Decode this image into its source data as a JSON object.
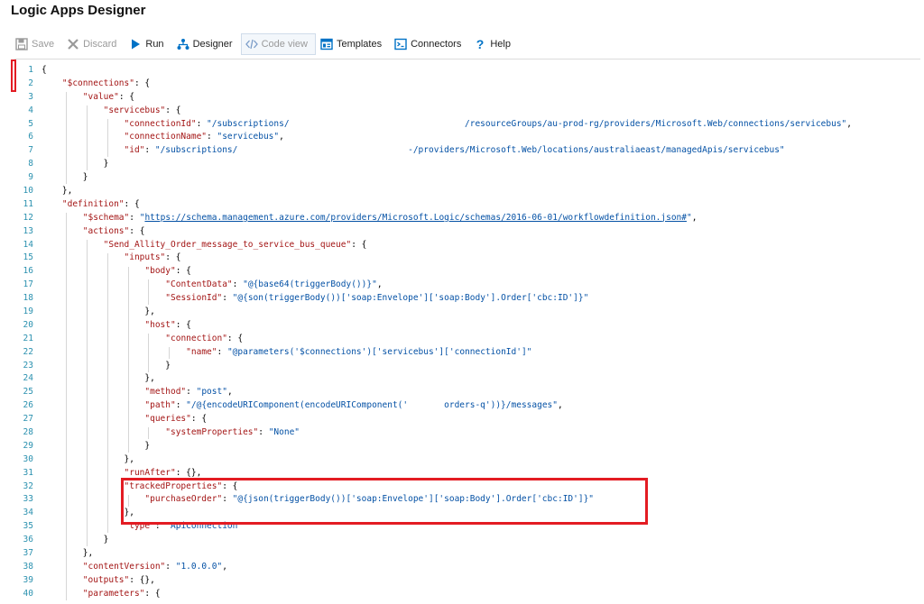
{
  "window": {
    "title": "Logic Apps Designer"
  },
  "toolbar": {
    "buttons": [
      {
        "id": "save",
        "label": "Save",
        "icon": "save-icon",
        "state": "disabled"
      },
      {
        "id": "discard",
        "label": "Discard",
        "icon": "close-icon",
        "state": "disabled"
      },
      {
        "id": "run",
        "label": "Run",
        "icon": "play-icon",
        "state": "enabled"
      },
      {
        "id": "designer",
        "label": "Designer",
        "icon": "designer-icon",
        "state": "enabled"
      },
      {
        "id": "codeview",
        "label": "Code view",
        "icon": "code-icon",
        "state": "active"
      },
      {
        "id": "templates",
        "label": "Templates",
        "icon": "templates-icon",
        "state": "enabled"
      },
      {
        "id": "connectors",
        "label": "Connectors",
        "icon": "connectors-icon",
        "state": "enabled"
      },
      {
        "id": "help",
        "label": "Help",
        "icon": "help-icon",
        "state": "enabled"
      }
    ]
  },
  "colors": {
    "accent": "#0072c6",
    "highlight": "#e31c23",
    "key": "#a31515",
    "string": "#0451a5",
    "line_number": "#2b91af"
  },
  "code": {
    "lines": [
      "{",
      "    \"$connections\": {",
      "        \"value\": {",
      "            \"servicebus\": {",
      "                \"connectionId\": \"/subscriptions/                                  /resourceGroups/au-prod-rg/providers/Microsoft.Web/connections/servicebus\",",
      "                \"connectionName\": \"servicebus\",",
      "                \"id\": \"/subscriptions/                                 -/providers/Microsoft.Web/locations/australiaeast/managedApis/servicebus\"",
      "            }",
      "        }",
      "    },",
      "    \"definition\": {",
      "        \"$schema\": \"https://schema.management.azure.com/providers/Microsoft.Logic/schemas/2016-06-01/workflowdefinition.json#\",",
      "        \"actions\": {",
      "            \"Send_Allity_Order_message_to_service_bus_queue\": {",
      "                \"inputs\": {",
      "                    \"body\": {",
      "                        \"ContentData\": \"@{base64(triggerBody())}\",",
      "                        \"SessionId\": \"@{son(triggerBody())['soap:Envelope']['soap:Body'].Order['cbc:ID']}\"",
      "                    },",
      "                    \"host\": {",
      "                        \"connection\": {",
      "                            \"name\": \"@parameters('$connections')['servicebus']['connectionId']\"",
      "                        }",
      "                    },",
      "                    \"method\": \"post\",",
      "                    \"path\": \"/@{encodeURIComponent(encodeURIComponent('       orders-q'))}/messages\",",
      "                    \"queries\": {",
      "                        \"systemProperties\": \"None\"",
      "                    }",
      "                },",
      "                \"runAfter\": {},",
      "                \"trackedProperties\": {",
      "                    \"purchaseOrder\": \"@{json(triggerBody())['soap:Envelope']['soap:Body'].Order['cbc:ID']}\"",
      "                },",
      "                \"type\": \"ApiConnection\"",
      "            }",
      "        },",
      "        \"contentVersion\": \"1.0.0.0\",",
      "        \"outputs\": {},",
      "        \"parameters\": {"
    ]
  }
}
